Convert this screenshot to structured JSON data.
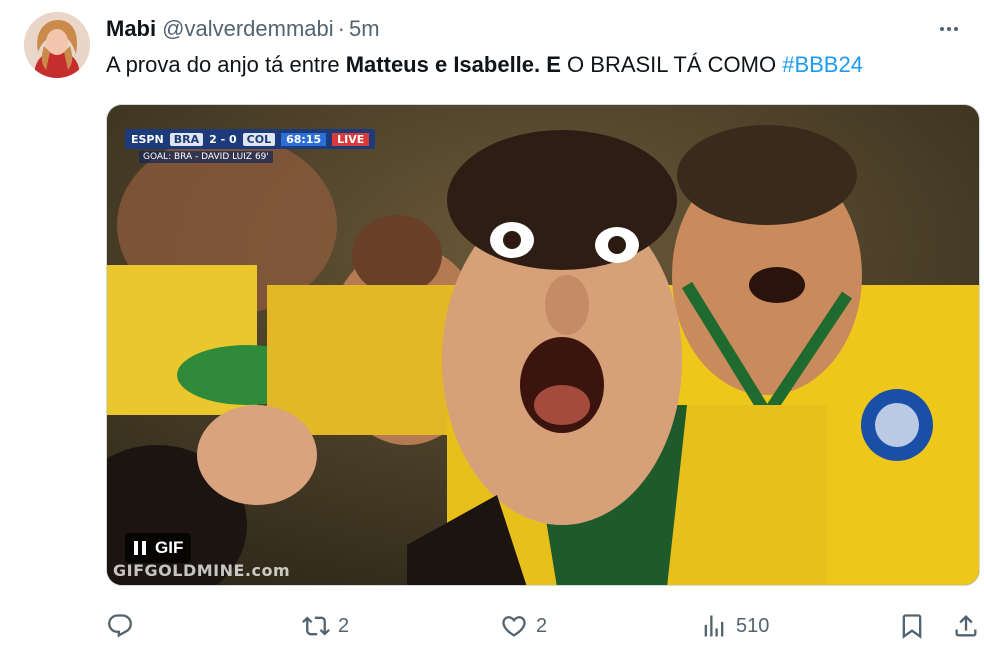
{
  "author": {
    "name": "Mabi",
    "handle": "@valverdemmabi",
    "separator": "·",
    "time": "5m"
  },
  "tweet": {
    "text_part1": "A prova do anjo tá entre ",
    "text_bold": "Matteus e Isabelle. E",
    "text_part2": " O BRASIL TÁ COMO ",
    "hashtag": "#BBB24"
  },
  "media": {
    "type": "gif",
    "badge_label": "GIF",
    "watermark": "GIFGOLDMINE.com",
    "scoreboard": {
      "channel": "ESPN",
      "home": "BRA",
      "score": "2 - 0",
      "away": "COL",
      "clock": "68:15",
      "tag": "LIVE",
      "subline": "GOAL: BRA - DAVID LUIZ 69'"
    }
  },
  "actions": {
    "replies": "",
    "reposts": "2",
    "likes": "2",
    "views": "510"
  },
  "colors": {
    "accent": "#1d9bf0",
    "muted": "#536471",
    "text": "#0f1419"
  },
  "icons": [
    "more-icon",
    "reply-icon",
    "repost-icon",
    "like-icon",
    "views-icon",
    "bookmark-icon",
    "share-icon",
    "pause-icon"
  ]
}
